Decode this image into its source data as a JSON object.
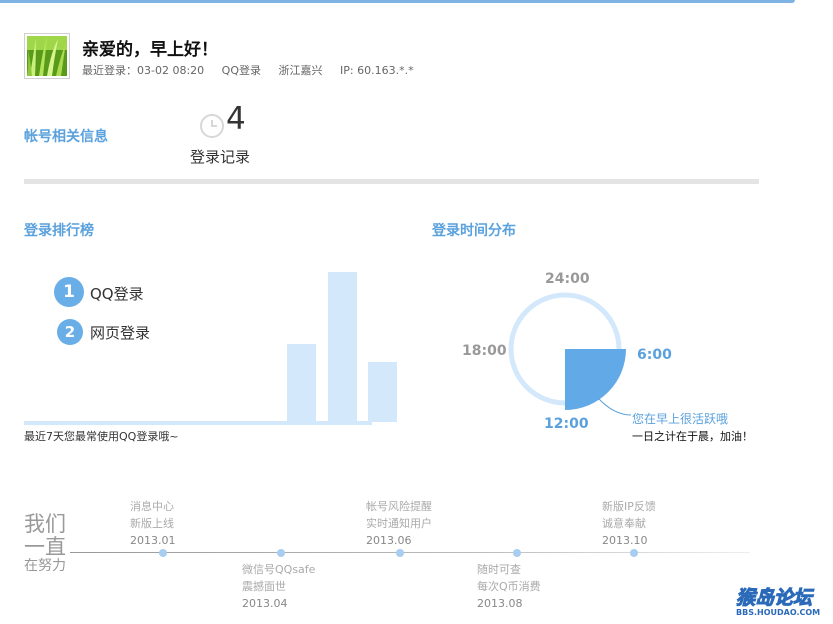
{
  "header": {
    "greeting": "亲爱的，早上好！",
    "last_login_time": "最近登录：03-02  08:20",
    "last_login_method": "QQ登录",
    "last_login_location": "浙江嘉兴",
    "last_login_ip": "IP:  60.163.*.*",
    "avatar_icon": "grass-avatar-image"
  },
  "account": {
    "title": "帐号相关信息",
    "login_count": "4",
    "login_label": "登录记录",
    "clock_icon": "clock-icon"
  },
  "ranking": {
    "title": "登录排行榜",
    "items": [
      {
        "rank": "1",
        "label": "QQ登录"
      },
      {
        "rank": "2",
        "label": "网页登录"
      }
    ],
    "note": "最近7天您最常使用QQ登录哦~"
  },
  "distribution": {
    "title": "登录时间分布",
    "labels": {
      "top": "24:00",
      "left": "18:00",
      "right": "6:00",
      "bottom": "12:00"
    },
    "highlight_quadrant": "6:00-12:00",
    "note1": "您在早上很活跃哦",
    "note2": "一日之计在于晨，加油！"
  },
  "timeline": {
    "motto": [
      "我们",
      "一直",
      "在努力"
    ],
    "events": [
      {
        "line1": "消息中心",
        "line2": "新版上线",
        "date": "2013.01"
      },
      {
        "line1": "微信号QQsafe",
        "line2": "震撼面世",
        "date": "2013.04"
      },
      {
        "line1": "帐号风险提醒",
        "line2": "实时通知用户",
        "date": "2013.06"
      },
      {
        "line1": "随时可查",
        "line2": "每次Q币消费",
        "date": "2013.08"
      },
      {
        "line1": "新版IP反馈",
        "line2": "诚意奉献",
        "date": "2013.10"
      }
    ]
  },
  "watermark": {
    "main": "猴岛论坛",
    "sub": "BBS.HOUDAO.COM"
  },
  "chart_data": {
    "type": "bar",
    "title": "",
    "categories": [
      "",
      "",
      "",
      "",
      "",
      "",
      ""
    ],
    "values": [
      0,
      0,
      0,
      0,
      0.52,
      1.0,
      0.4
    ],
    "xlabel": "",
    "ylabel": "",
    "grid": false,
    "legend": "none"
  },
  "colors": {
    "accent": "#5aa1dd",
    "badge": "#6aaee8",
    "bar": "#d3e8fb",
    "quadrant": "#62a9e8"
  }
}
